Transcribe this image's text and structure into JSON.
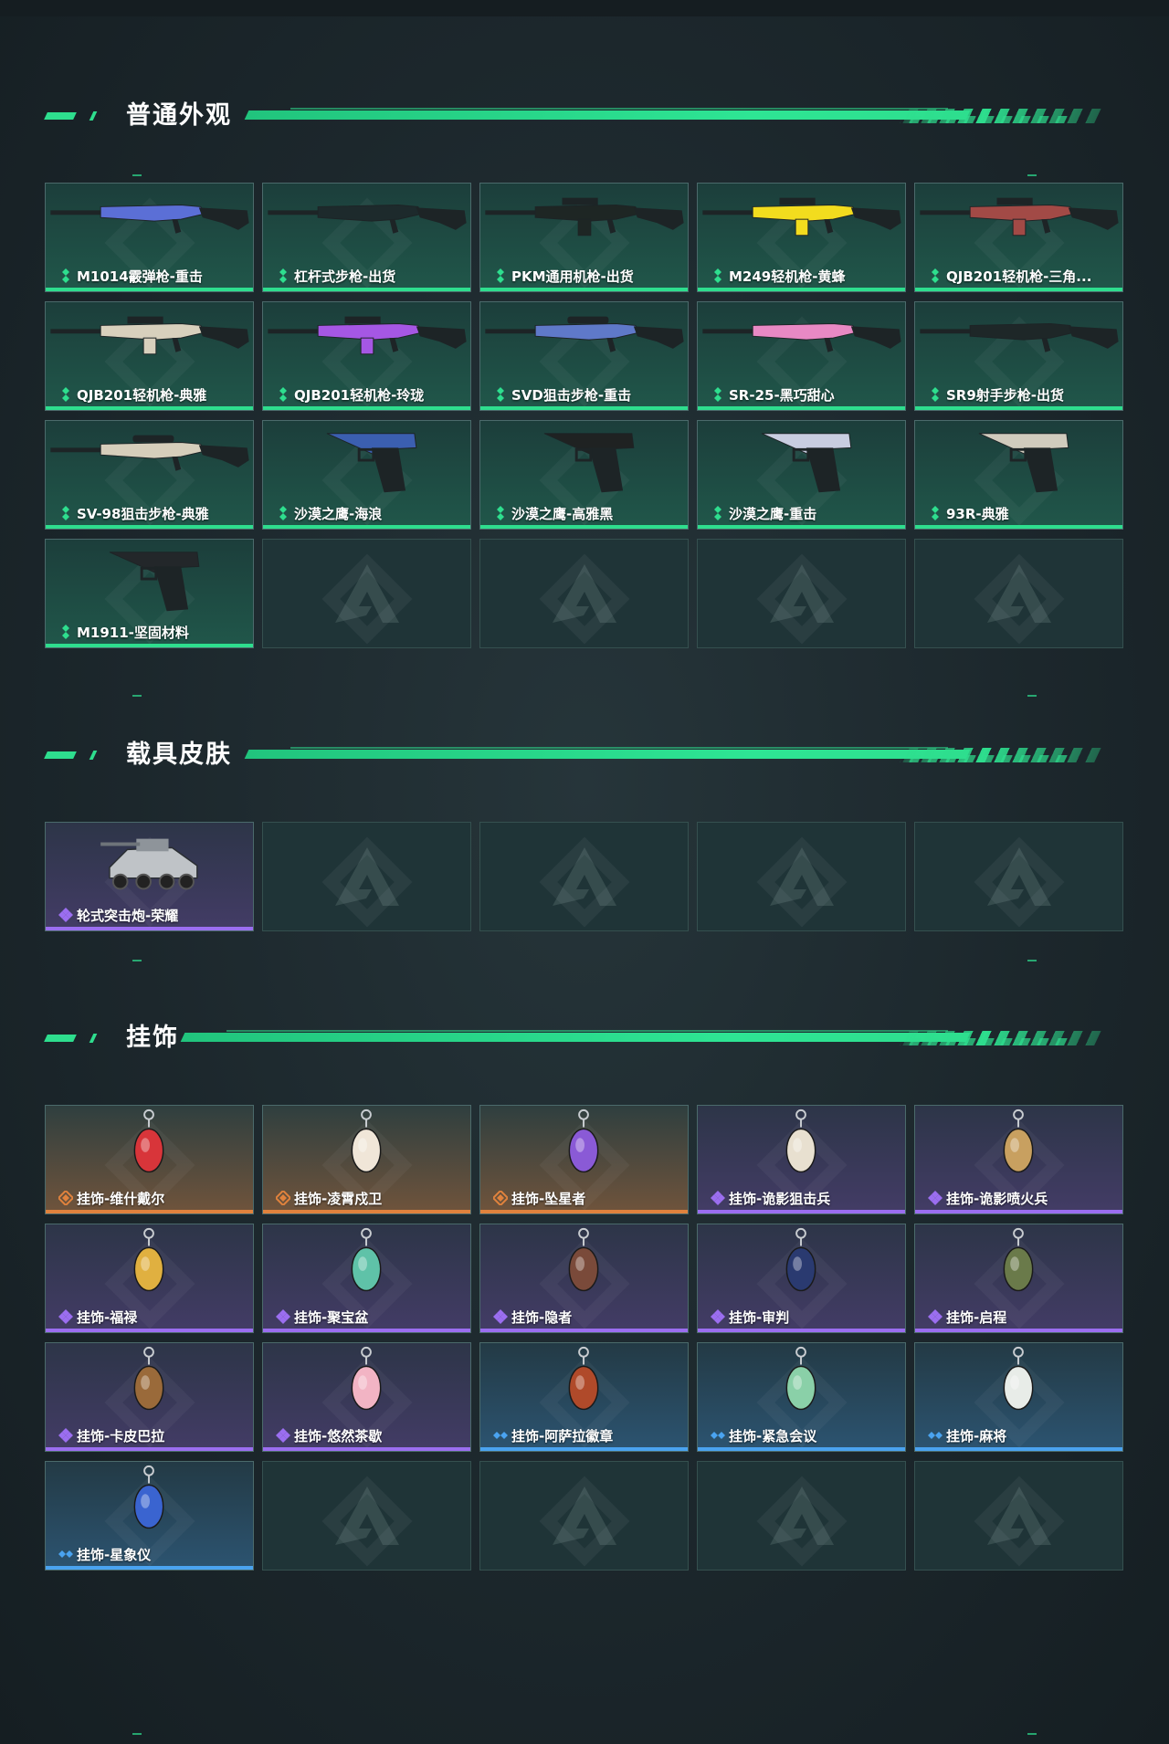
{
  "sections": [
    {
      "title": "普通外观",
      "items": [
        {
          "label": "M1014霰弹枪-重击",
          "rarity": "green",
          "icon": "shotgun-icon",
          "color": "#5b6fd6"
        },
        {
          "label": "杠杆式步枪-出货",
          "rarity": "green",
          "icon": "lever-rifle-icon",
          "color": "#1d2a2c"
        },
        {
          "label": "PKM通用机枪-出货",
          "rarity": "green",
          "icon": "machine-gun-icon",
          "color": "#1e2624"
        },
        {
          "label": "M249轻机枪-黄蜂",
          "rarity": "green",
          "icon": "light-machine-gun-icon",
          "color": "#f2dc1e"
        },
        {
          "label": "QJB201轻机枪-三角...",
          "rarity": "green",
          "icon": "light-machine-gun-icon",
          "color": "#a24a46"
        },
        {
          "label": "QJB201轻机枪-典雅",
          "rarity": "green",
          "icon": "light-machine-gun-icon",
          "color": "#d8d0bd"
        },
        {
          "label": "QJB201轻机枪-玲珑",
          "rarity": "green",
          "icon": "light-machine-gun-icon",
          "color": "#a557e4"
        },
        {
          "label": "SVD狙击步枪-重击",
          "rarity": "green",
          "icon": "sniper-rifle-icon",
          "color": "#5f79c9"
        },
        {
          "label": "SR-25-黑巧甜心",
          "rarity": "green",
          "icon": "rifle-icon",
          "color": "#e889c4"
        },
        {
          "label": "SR9射手步枪-出货",
          "rarity": "green",
          "icon": "rifle-icon",
          "color": "#1e2728"
        },
        {
          "label": "SV-98狙击步枪-典雅",
          "rarity": "green",
          "icon": "sniper-rifle-icon",
          "color": "#d6cebb"
        },
        {
          "label": "沙漠之鹰-海浪",
          "rarity": "green",
          "icon": "pistol-icon",
          "color": "#3b5fb0"
        },
        {
          "label": "沙漠之鹰-高雅黑",
          "rarity": "green",
          "icon": "pistol-icon",
          "color": "#1f2222"
        },
        {
          "label": "沙漠之鹰-重击",
          "rarity": "green",
          "icon": "pistol-icon",
          "color": "#c8cde0"
        },
        {
          "label": "93R-典雅",
          "rarity": "green",
          "icon": "pistol-icon",
          "color": "#d0cbbd"
        },
        {
          "label": "M1911-坚固材料",
          "rarity": "green",
          "icon": "pistol-icon",
          "color": "#23272a"
        }
      ]
    },
    {
      "title": "载具皮肤",
      "items": [
        {
          "label": "轮式突击炮-荣耀",
          "rarity": "purple",
          "icon": "vehicle-icon",
          "color": "#bfc3c7"
        }
      ]
    },
    {
      "title": "挂饰",
      "items": [
        {
          "label": "挂饰-维什戴尔",
          "rarity": "orange",
          "icon": "charm-icon",
          "color": "#d8353a"
        },
        {
          "label": "挂饰-凌霄戍卫",
          "rarity": "orange",
          "icon": "charm-icon",
          "color": "#f0e6d8"
        },
        {
          "label": "挂饰-坠星者",
          "rarity": "orange",
          "icon": "charm-icon",
          "color": "#8a5ad6"
        },
        {
          "label": "挂饰-诡影狙击兵",
          "rarity": "purple",
          "icon": "charm-icon",
          "color": "#e8e0d0"
        },
        {
          "label": "挂饰-诡影喷火兵",
          "rarity": "purple",
          "icon": "charm-icon",
          "color": "#c8a060"
        },
        {
          "label": "挂饰-福禄",
          "rarity": "purple",
          "icon": "charm-icon",
          "color": "#e0b040"
        },
        {
          "label": "挂饰-聚宝盆",
          "rarity": "purple",
          "icon": "charm-icon",
          "color": "#5fc2a8"
        },
        {
          "label": "挂饰-隐者",
          "rarity": "purple",
          "icon": "charm-icon",
          "color": "#7a4a3a"
        },
        {
          "label": "挂饰-审判",
          "rarity": "purple",
          "icon": "charm-icon",
          "color": "#2a3a70"
        },
        {
          "label": "挂饰-启程",
          "rarity": "purple",
          "icon": "charm-icon",
          "color": "#6a7a4a"
        },
        {
          "label": "挂饰-卡皮巴拉",
          "rarity": "purple",
          "icon": "charm-icon",
          "color": "#9a6a3a"
        },
        {
          "label": "挂饰-悠然茶歇",
          "rarity": "purple",
          "icon": "charm-icon",
          "color": "#f2b4c4"
        },
        {
          "label": "挂饰-阿萨拉徽章",
          "rarity": "blue",
          "icon": "charm-icon",
          "color": "#b04a2a"
        },
        {
          "label": "挂饰-紧急会议",
          "rarity": "blue",
          "icon": "charm-icon",
          "color": "#8ad0a8"
        },
        {
          "label": "挂饰-麻将",
          "rarity": "blue",
          "icon": "charm-icon",
          "color": "#e8ece8"
        },
        {
          "label": "挂饰-星象仪",
          "rarity": "blue",
          "icon": "charm-icon",
          "color": "#3a64d0"
        }
      ]
    }
  ],
  "rarity_colors": {
    "green": "#2ede8e",
    "purple": "#9b6ef0",
    "orange": "#e0823d",
    "blue": "#4aa3f0"
  }
}
